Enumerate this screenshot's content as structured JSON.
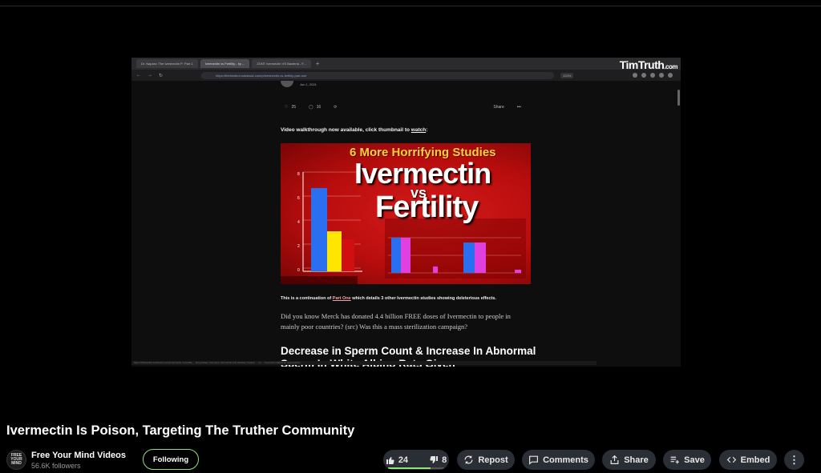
{
  "browser": {
    "tabs": [
      "Dr. Naparo: The Ivermectin P: Part 1",
      "Ivermectin vs Fertility - by ...",
      "ZDNT Ivermectin VS Bacteria - F..."
    ],
    "url": "https://thebestbot.substack.com/p/ivermectin-vs-fertility-part-one",
    "zoom": "133%",
    "watermark": "TimTruth",
    "watermark_suffix": ".com",
    "status_text": "https://thebestbot.substack.com/p/ivermectin-vs-fertility ... Drug Safety Concerns: Ivermectin Anti-Infective Caution ... lol ... Ivermectin effects on reproductive"
  },
  "article": {
    "date": "Jun 1, 2021",
    "likes": "25",
    "comments": "16",
    "share_label": "Share",
    "video_note_prefix": "Video walkthrough now available, click thumbnail to ",
    "video_note_link": "watch",
    "video_note_suffix": ":",
    "thumbnail": {
      "subtitle": "6 More Horrifying Studies",
      "line1": "Ivermectin",
      "vs": "vs",
      "line2": "Fertility"
    },
    "para1_prefix": "This is a continuation of ",
    "para1_link": "Part One",
    "para1_suffix": " which details 3 other Ivermectin studies showing deleterious effects.",
    "para2": "Did you know Merck has donated 4.4 billion FREE doses of Ivermectin to people in mainly poor countries? (src) Was this a mass sterilization campaign?",
    "heading": "Decrease in Sperm Count & Increase In Abnormal Sperm In White Albino Rats Given"
  },
  "video": {
    "title": "Ivermectin Is Poison, Targeting The Truther Community"
  },
  "channel": {
    "avatar_text": "FREE YOUR MIND",
    "name": "Free Your Mind Videos",
    "followers": "56.6K followers",
    "follow_label": "Following"
  },
  "toolbar": {
    "likes": "24",
    "dislikes": "8",
    "like_ratio": 0.75,
    "repost": "Repost",
    "comments": "Comments",
    "share": "Share",
    "save": "Save",
    "embed": "Embed"
  },
  "colors": {
    "background": "#000000",
    "pill": "#2a2f36",
    "accent_green": "#8ee27a",
    "thumb_red": "#c81212",
    "thumb_yellow": "#ffd23a"
  }
}
